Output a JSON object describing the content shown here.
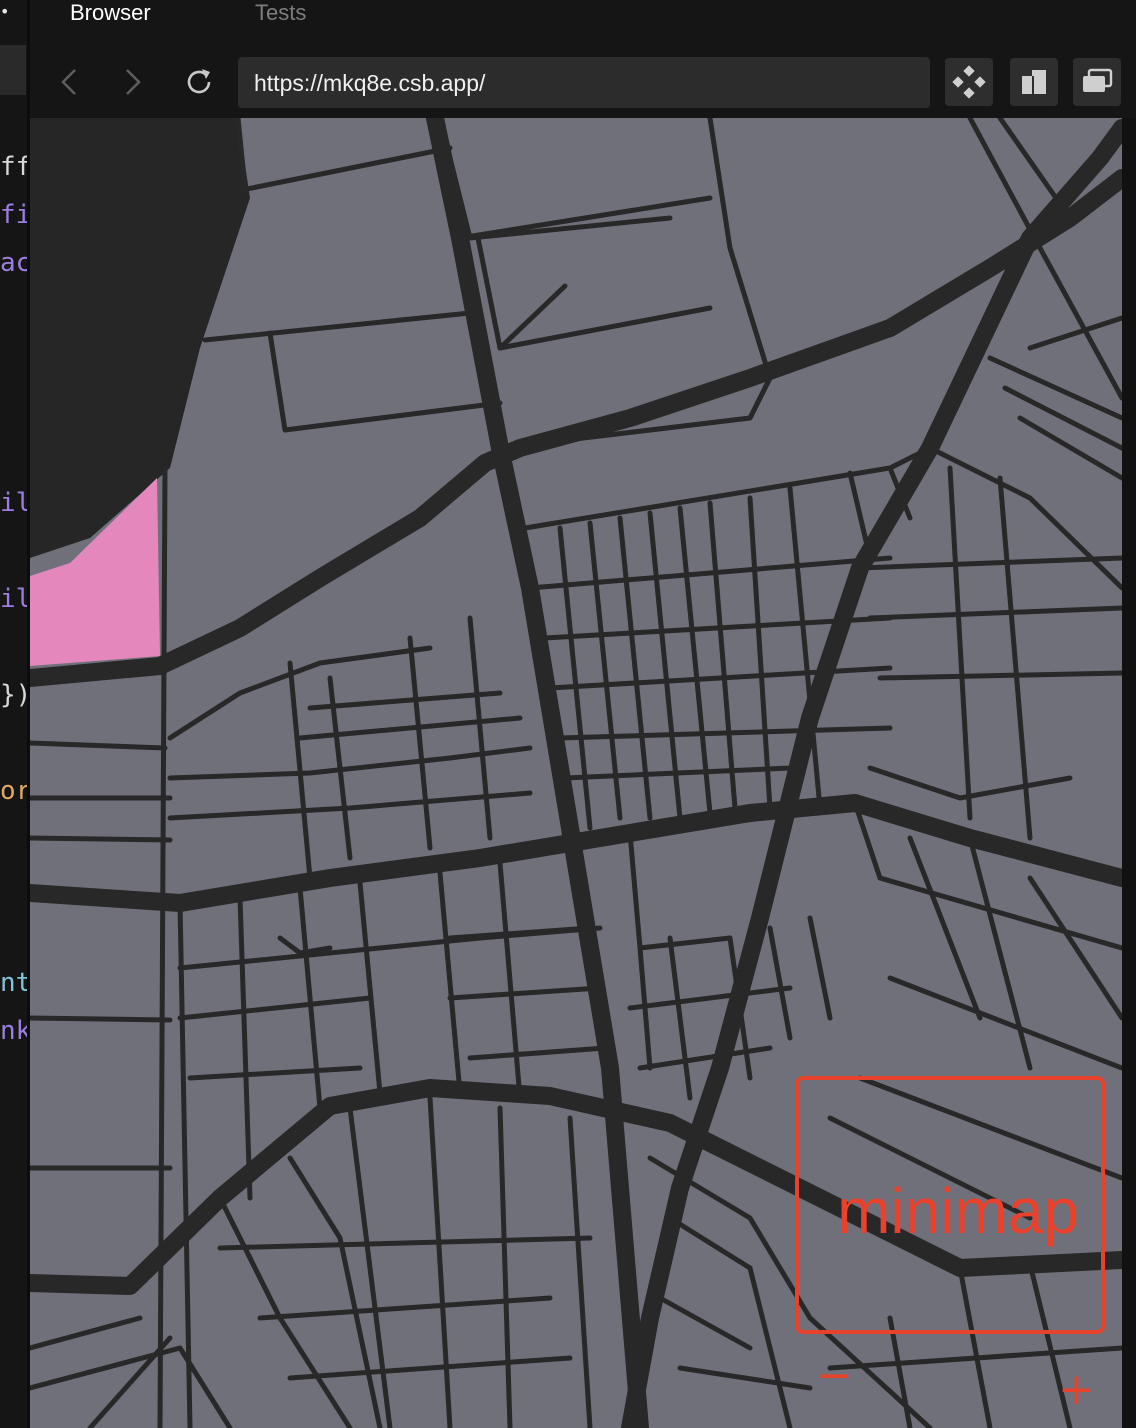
{
  "editor": {
    "tab_dot": "•",
    "code_fragments": [
      {
        "text": "ff",
        "color": "#d8d8d8"
      },
      {
        "text": "fi",
        "color": "#9b7ee0"
      },
      {
        "text": "ac",
        "color": "#9b7ee0"
      },
      {
        "text": "il",
        "color": "#9b7ee0"
      },
      {
        "text": "il",
        "color": "#9b7ee0"
      },
      {
        "text": "})",
        "color": "#d8d8d8"
      },
      {
        "text": "or",
        "color": "#e0a860"
      },
      {
        "text": "nt",
        "color": "#7fc3d8"
      },
      {
        "text": "nk",
        "color": "#9b7ee0"
      }
    ]
  },
  "browser": {
    "tabs": [
      {
        "label": "Browser",
        "active": true
      },
      {
        "label": "Tests",
        "active": false
      }
    ],
    "url": "https://mkq8e.csb.app/",
    "icons": {
      "back": "chevron-left-icon",
      "forward": "chevron-right-icon",
      "reload": "reload-icon",
      "tool1": "diamond-grid-icon",
      "tool2": "split-view-icon",
      "tool3": "windows-icon"
    }
  },
  "map": {
    "colors": {
      "land": "#70707b",
      "road": "#282828",
      "water": "#262626",
      "highlight": "#e387bc",
      "minimap": "#e8412c"
    },
    "minimap_label": "minimap",
    "zoom_out": "−",
    "zoom_in": "+"
  }
}
